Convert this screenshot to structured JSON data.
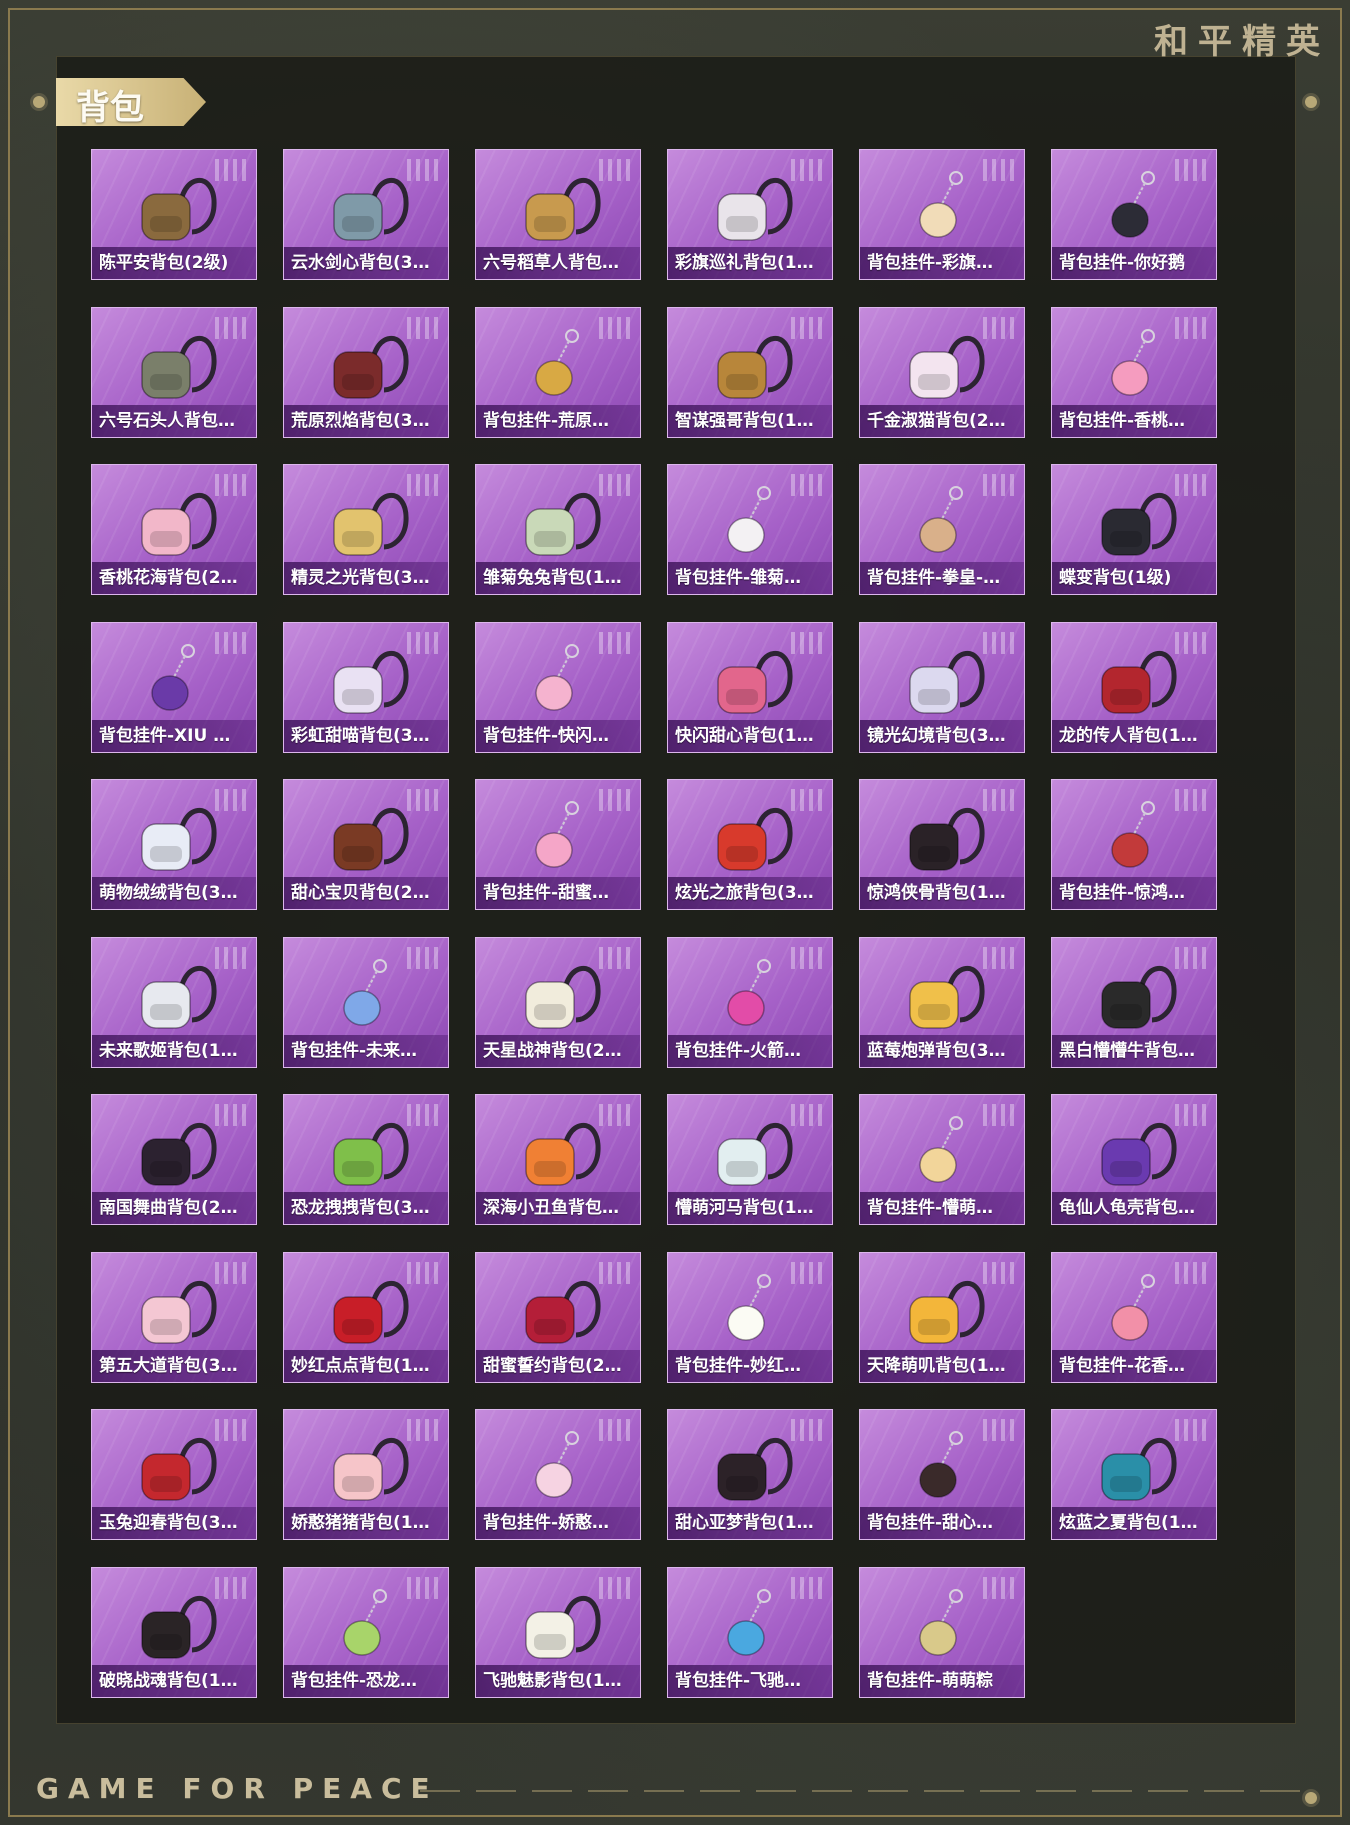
{
  "header": {
    "brand_cn": "和平精英"
  },
  "section": {
    "title": "背包"
  },
  "footer": {
    "brand_en": "GAME FOR PEACE"
  },
  "items": [
    {
      "name": "陈平安背包(2级)",
      "icon": "backpack-icon",
      "color": "#8a6a3e"
    },
    {
      "name": "云水剑心背包(3…",
      "icon": "backpack-icon",
      "color": "#7f9aa8"
    },
    {
      "name": "六号稻草人背包…",
      "icon": "backpack-icon",
      "color": "#c89a4e"
    },
    {
      "name": "彩旗巡礼背包(1…",
      "icon": "backpack-icon",
      "color": "#e9e4ea"
    },
    {
      "name": "背包挂件-彩旗…",
      "icon": "pendant-icon",
      "color": "#f1dcb8"
    },
    {
      "name": "背包挂件-你好鹅",
      "icon": "pendant-icon",
      "color": "#2c2c36"
    },
    {
      "name": "六号石头人背包…",
      "icon": "backpack-icon",
      "color": "#7a7f6a"
    },
    {
      "name": "荒原烈焰背包(3…",
      "icon": "backpack-icon",
      "color": "#7b2b2b"
    },
    {
      "name": "背包挂件-荒原…",
      "icon": "pendant-icon",
      "color": "#d8a944"
    },
    {
      "name": "智谋强哥背包(1…",
      "icon": "backpack-icon",
      "color": "#b8863a"
    },
    {
      "name": "千金淑猫背包(2…",
      "icon": "backpack-icon",
      "color": "#f3e4ef"
    },
    {
      "name": "背包挂件-香桃…",
      "icon": "pendant-icon",
      "color": "#f59cbf"
    },
    {
      "name": "香桃花海背包(2…",
      "icon": "backpack-icon",
      "color": "#f2b7c9"
    },
    {
      "name": "精灵之光背包(3…",
      "icon": "backpack-icon",
      "color": "#e2c36e"
    },
    {
      "name": "雏菊兔兔背包(1…",
      "icon": "backpack-icon",
      "color": "#c9d9b8"
    },
    {
      "name": "背包挂件-雏菊…",
      "icon": "pendant-icon",
      "color": "#f3f1f3"
    },
    {
      "name": "背包挂件-拳皇-…",
      "icon": "pendant-icon",
      "color": "#d9b08a"
    },
    {
      "name": "蝶变背包(1级)",
      "icon": "backpack-icon",
      "color": "#2a2a32"
    },
    {
      "name": "背包挂件-XIU …",
      "icon": "pendant-icon",
      "color": "#6a3aa8"
    },
    {
      "name": "彩虹甜喵背包(3…",
      "icon": "backpack-icon",
      "color": "#e9e1f3"
    },
    {
      "name": "背包挂件-快闪…",
      "icon": "pendant-icon",
      "color": "#f5b3cf"
    },
    {
      "name": "快闪甜心背包(1…",
      "icon": "backpack-icon",
      "color": "#e2668c"
    },
    {
      "name": "镜光幻境背包(3…",
      "icon": "backpack-icon",
      "color": "#dcd9ef"
    },
    {
      "name": "龙的传人背包(1…",
      "icon": "backpack-icon",
      "color": "#b3262e"
    },
    {
      "name": "萌物绒绒背包(3…",
      "icon": "backpack-icon",
      "color": "#e8ecf6"
    },
    {
      "name": "甜心宝贝背包(2…",
      "icon": "backpack-icon",
      "color": "#7a3a24"
    },
    {
      "name": "背包挂件-甜蜜…",
      "icon": "pendant-icon",
      "color": "#f5a6c8"
    },
    {
      "name": "炫光之旅背包(3…",
      "icon": "backpack-icon",
      "color": "#d83a2c"
    },
    {
      "name": "惊鸿侠骨背包(1…",
      "icon": "backpack-icon",
      "color": "#2a2227"
    },
    {
      "name": "背包挂件-惊鸿…",
      "icon": "pendant-icon",
      "color": "#c23a3a"
    },
    {
      "name": "未来歌姬背包(1…",
      "icon": "backpack-icon",
      "color": "#e7e9ef"
    },
    {
      "name": "背包挂件-未来…",
      "icon": "pendant-icon",
      "color": "#7fa8e8"
    },
    {
      "name": "天星战神背包(2…",
      "icon": "backpack-icon",
      "color": "#f1ecdc"
    },
    {
      "name": "背包挂件-火箭…",
      "icon": "pendant-icon",
      "color": "#e24ca8"
    },
    {
      "name": "蓝莓炮弹背包(3…",
      "icon": "backpack-icon",
      "color": "#f0c04a"
    },
    {
      "name": "黑白懵懵牛背包…",
      "icon": "backpack-icon",
      "color": "#2a2a2a"
    },
    {
      "name": "南国舞曲背包(2…",
      "icon": "backpack-icon",
      "color": "#2c2230"
    },
    {
      "name": "恐龙拽拽背包(3…",
      "icon": "backpack-icon",
      "color": "#7fbf4a"
    },
    {
      "name": "深海小丑鱼背包…",
      "icon": "backpack-icon",
      "color": "#f08034"
    },
    {
      "name": "懵萌河马背包(1…",
      "icon": "backpack-icon",
      "color": "#e2eef0"
    },
    {
      "name": "背包挂件-懵萌…",
      "icon": "pendant-icon",
      "color": "#f2d59a"
    },
    {
      "name": "龟仙人龟壳背包…",
      "icon": "backpack-icon",
      "color": "#6a3ab0"
    },
    {
      "name": "第五大道背包(3…",
      "icon": "backpack-icon",
      "color": "#f4c7d3"
    },
    {
      "name": "妙红点点背包(1…",
      "icon": "backpack-icon",
      "color": "#c81e28"
    },
    {
      "name": "甜蜜誓约背包(2…",
      "icon": "backpack-icon",
      "color": "#b41e38"
    },
    {
      "name": "背包挂件-妙红…",
      "icon": "pendant-icon",
      "color": "#fbfbf4"
    },
    {
      "name": "天降萌叽背包(1…",
      "icon": "backpack-icon",
      "color": "#f3b63a"
    },
    {
      "name": "背包挂件-花香…",
      "icon": "pendant-icon",
      "color": "#f290a8"
    },
    {
      "name": "玉兔迎春背包(3…",
      "icon": "backpack-icon",
      "color": "#c4282e"
    },
    {
      "name": "娇憨猪猪背包(1…",
      "icon": "backpack-icon",
      "color": "#f6c5c9"
    },
    {
      "name": "背包挂件-娇憨…",
      "icon": "pendant-icon",
      "color": "#f6d3e2"
    },
    {
      "name": "甜心亚梦背包(1…",
      "icon": "backpack-icon",
      "color": "#2c2228"
    },
    {
      "name": "背包挂件-甜心…",
      "icon": "pendant-icon",
      "color": "#3a2a2a"
    },
    {
      "name": "炫蓝之夏背包(1…",
      "icon": "backpack-icon",
      "color": "#2a8fa8"
    },
    {
      "name": "破晓战魂背包(1…",
      "icon": "backpack-icon",
      "color": "#2a2426"
    },
    {
      "name": "背包挂件-恐龙…",
      "icon": "pendant-icon",
      "color": "#a8d46a"
    },
    {
      "name": "飞驰魅影背包(1…",
      "icon": "backpack-icon",
      "color": "#f3f1e6"
    },
    {
      "name": "背包挂件-飞驰…",
      "icon": "pendant-icon",
      "color": "#4aa8e0"
    },
    {
      "name": "背包挂件-萌萌粽",
      "icon": "pendant-icon",
      "color": "#d9c98a"
    }
  ]
}
